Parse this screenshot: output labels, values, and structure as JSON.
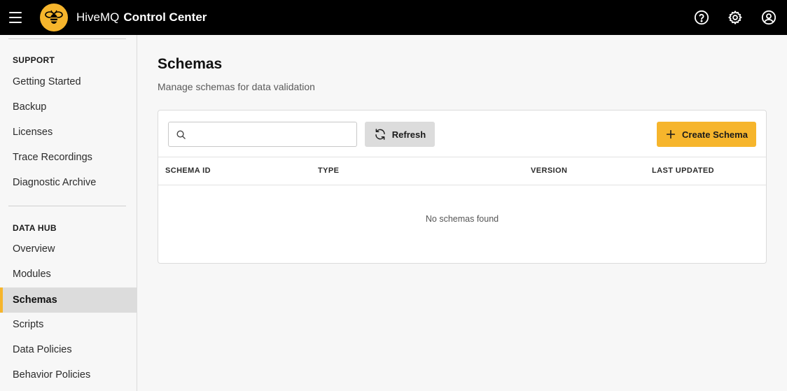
{
  "header": {
    "brand_name": "HiveMQ",
    "brand_product": "Control Center"
  },
  "icons": {
    "menu": "hamburger-menu-icon",
    "logo": "bee-logo-icon",
    "help": "help-circle-icon",
    "settings": "gear-icon",
    "account": "user-circle-icon",
    "search": "search-icon",
    "refresh": "refresh-icon",
    "add": "plus-icon"
  },
  "colors": {
    "accent": "#f6b52c",
    "topbar": "#000000",
    "active_nav": "#dcdcdc"
  },
  "sidebar": {
    "support_title": "SUPPORT",
    "support_items": [
      {
        "label": "Getting Started"
      },
      {
        "label": "Backup"
      },
      {
        "label": "Licenses"
      },
      {
        "label": "Trace Recordings"
      },
      {
        "label": "Diagnostic Archive"
      }
    ],
    "datahub_title": "DATA HUB",
    "datahub_items": [
      {
        "label": "Overview"
      },
      {
        "label": "Modules"
      },
      {
        "label": "Schemas",
        "active": true
      },
      {
        "label": "Scripts"
      },
      {
        "label": "Data Policies"
      },
      {
        "label": "Behavior Policies"
      }
    ]
  },
  "main": {
    "title": "Schemas",
    "subtitle": "Manage schemas for data validation",
    "search": {
      "value": "",
      "placeholder": ""
    },
    "refresh_label": "Refresh",
    "create_label": "Create Schema",
    "columns": [
      "SCHEMA ID",
      "TYPE",
      "VERSION",
      "LAST UPDATED"
    ],
    "empty_text": "No schemas found"
  }
}
